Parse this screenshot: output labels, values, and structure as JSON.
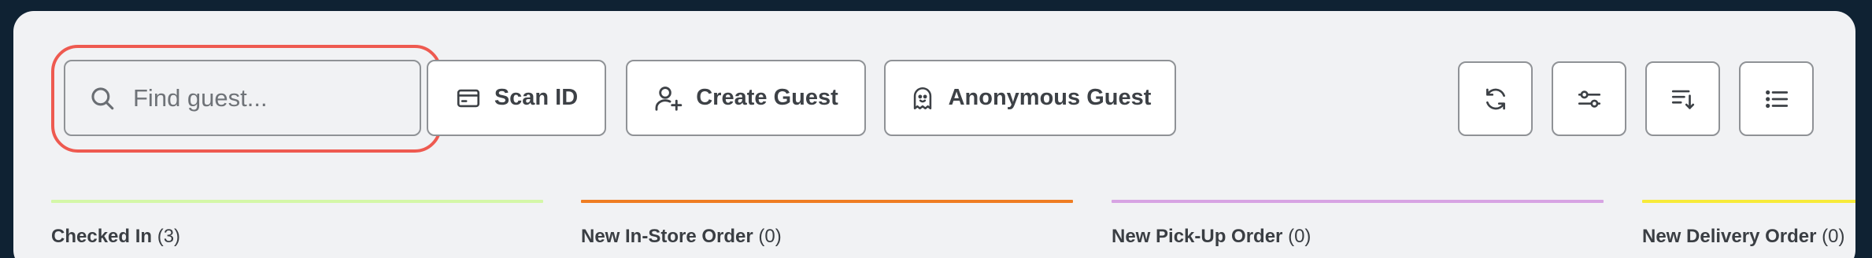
{
  "search": {
    "placeholder": "Find guest..."
  },
  "toolbar": {
    "scan_id_label": "Scan ID",
    "create_guest_label": "Create Guest",
    "anonymous_guest_label": "Anonymous Guest"
  },
  "icons": {
    "search": "search-icon",
    "scan_id": "id-card-icon",
    "create_guest": "user-plus-icon",
    "anonymous_guest": "ghost-icon",
    "refresh": "refresh-icon",
    "filter": "sliders-icon",
    "sort": "sort-icon",
    "list": "list-icon"
  },
  "columns": [
    {
      "name": "Checked In",
      "count": "(3)",
      "color": "#d4f7a8"
    },
    {
      "name": "New In-Store Order",
      "count": "(0)",
      "color": "#ef7d22"
    },
    {
      "name": "New Pick-Up Order",
      "count": "(0)",
      "color": "#d7a4e3"
    },
    {
      "name": "New Delivery Order",
      "count": "(0)",
      "color": "#f7ea3a"
    }
  ],
  "colors": {
    "highlight": "#ee5a50",
    "panel": "#f1f2f4",
    "background": "#0f2233"
  }
}
